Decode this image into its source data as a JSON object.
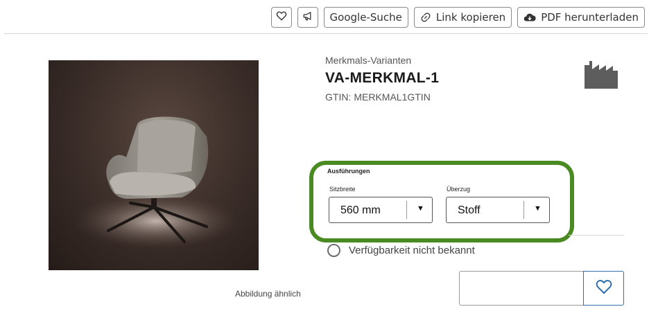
{
  "toolbar": {
    "favorite_icon": "heart-icon",
    "announce_icon": "megaphone-icon",
    "google_label": "Google-Suche",
    "copy_link_label": "Link kopieren",
    "copy_link_icon": "link-icon",
    "pdf_label": "PDF herunterladen",
    "pdf_icon": "cloud-download-icon"
  },
  "product": {
    "subtitle": "Merkmals-Varianten",
    "title": "VA-MERKMAL-1",
    "gtin_label": "GTIN:",
    "gtin_value": "MERKMAL1GTIN",
    "image_caption": "Abbildung ähnlich",
    "manufacturer_icon": "factory-icon"
  },
  "variants": {
    "heading": "Ausführungen",
    "highlight_color": "#4a8a22",
    "fields": [
      {
        "label": "Sitzbreite",
        "value": "560 mm"
      },
      {
        "label": "Überzug",
        "value": "Stoff"
      }
    ]
  },
  "availability": {
    "text": "Verfügbarkeit nicht bekannt"
  },
  "cart": {
    "quantity_value": "",
    "wishlist_icon": "heart-icon",
    "accent_color": "#2f6fb0"
  }
}
